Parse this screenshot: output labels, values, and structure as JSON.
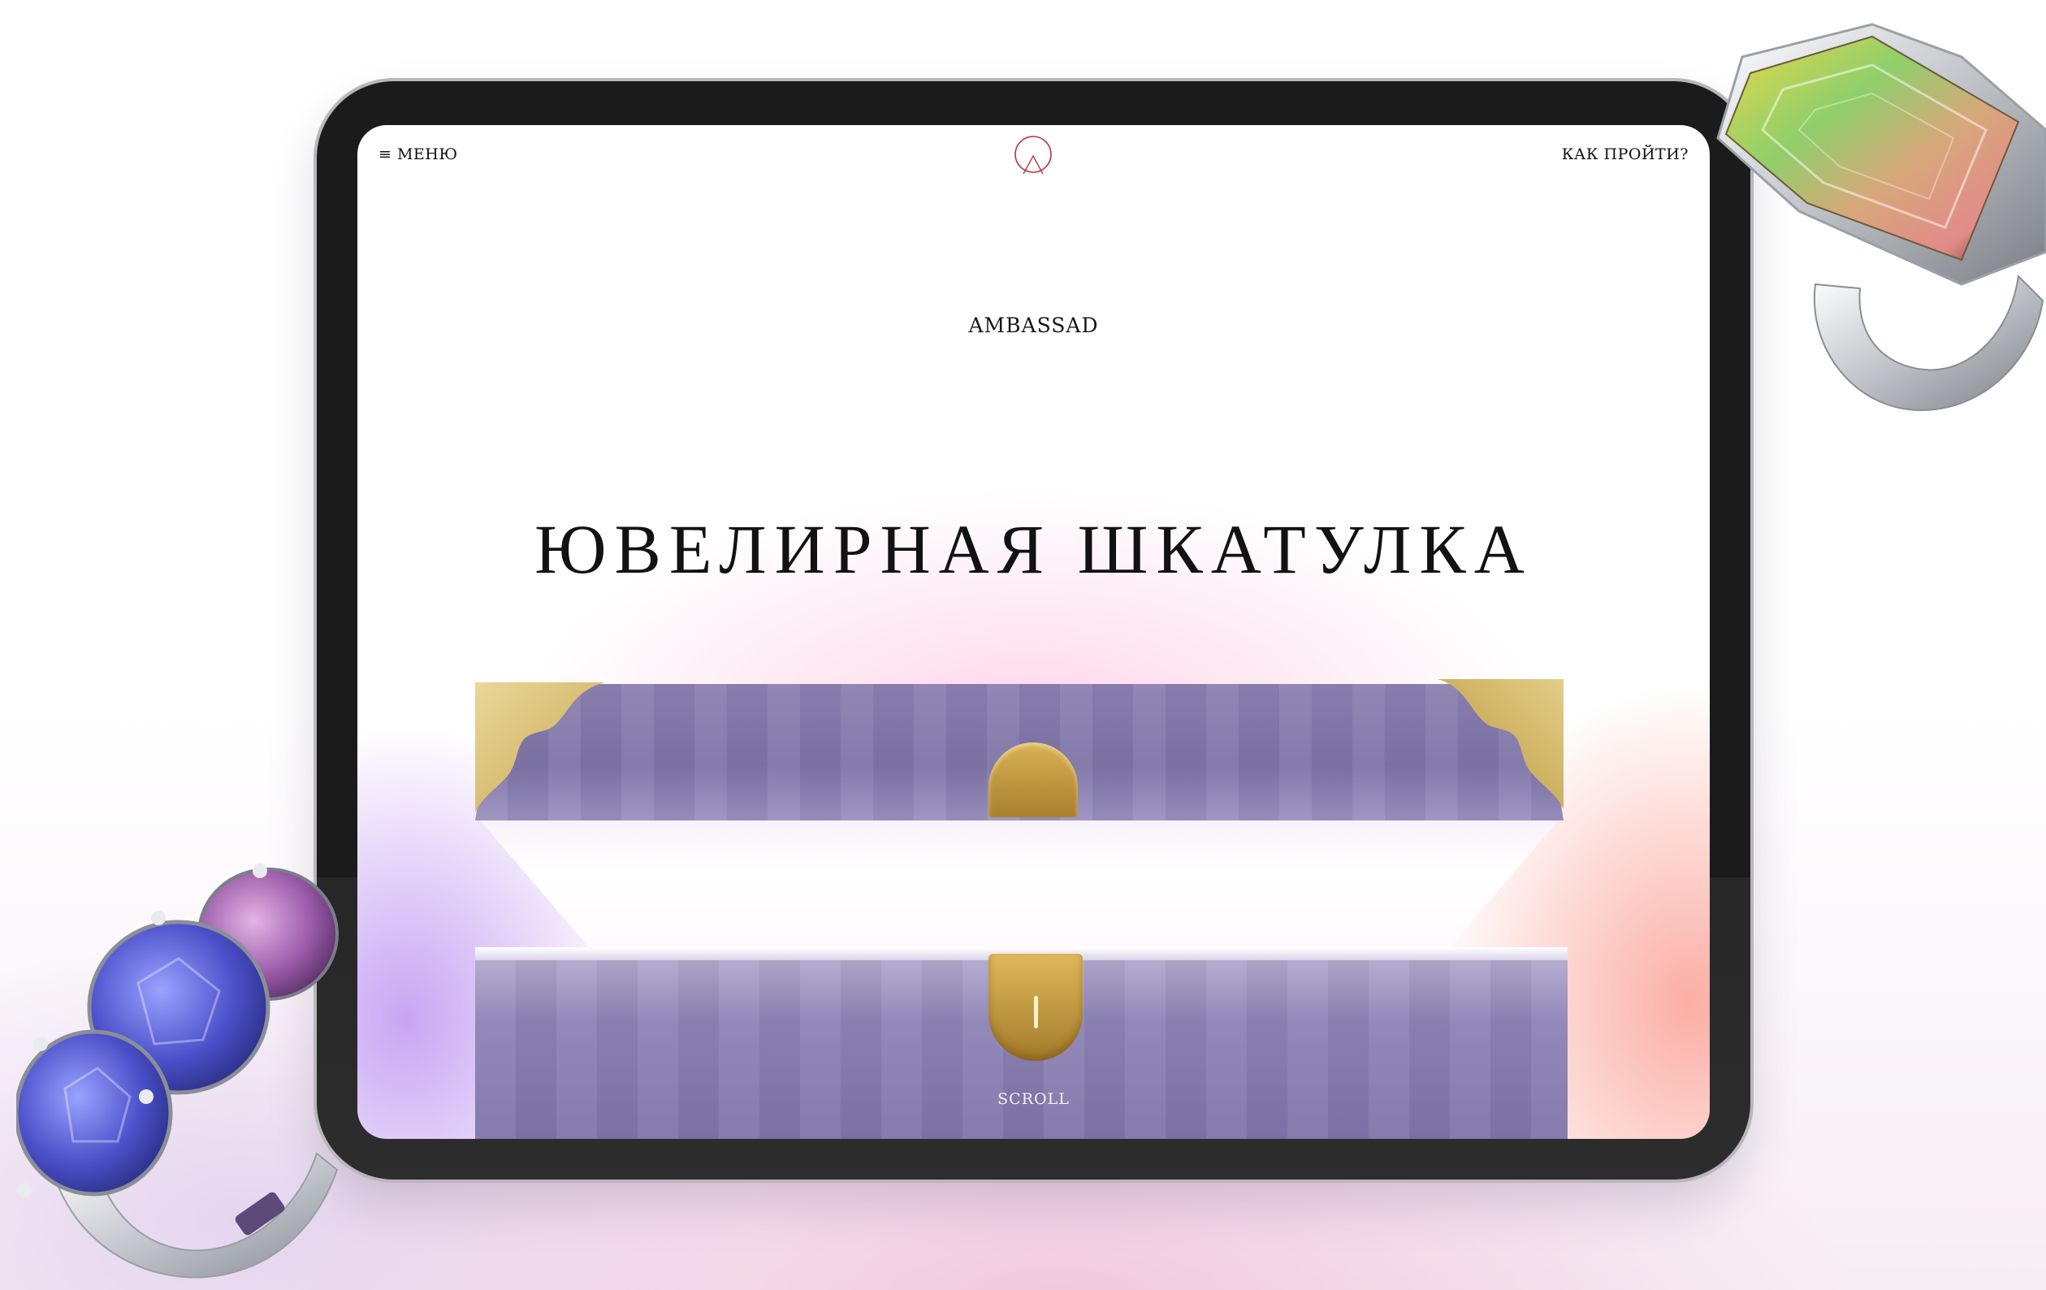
{
  "nav": {
    "menu_label": "≡ МЕНЮ",
    "route_label": "КАК ПРОЙТИ?",
    "logo_icon": "brand-logo-icon"
  },
  "hero": {
    "brand": "AMBASSAD",
    "title": "ЮВЕЛИРНАЯ ШКАТУЛКА",
    "scroll_label": "SCROLL"
  },
  "decor": {
    "ring_top_right": "tourmaline-ring-image",
    "ring_bottom_left": "sapphire-ring-image"
  },
  "colors": {
    "lid": "#8c80b0",
    "gold": "#c7a64e",
    "logo": "#b23a48"
  }
}
